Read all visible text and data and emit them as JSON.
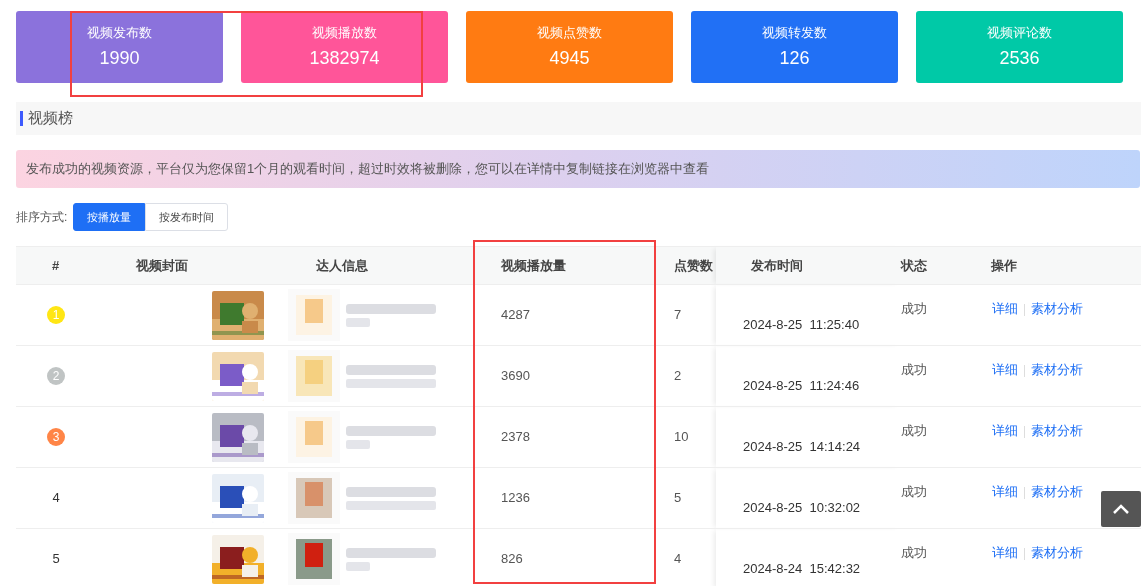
{
  "stats": [
    {
      "label": "视频发布数",
      "value": "1990",
      "color": "#8b72dc"
    },
    {
      "label": "视频播放数",
      "value": "1382974",
      "color": "#ff5599"
    },
    {
      "label": "视频点赞数",
      "value": "4945",
      "color": "#ff7b12"
    },
    {
      "label": "视频转发数",
      "value": "126",
      "color": "#2170f5"
    },
    {
      "label": "视频评论数",
      "value": "2536",
      "color": "#00c9a7"
    }
  ],
  "section_title": "视频榜",
  "notice": "发布成功的视频资源，平台仅为您保留1个月的观看时间，超过时效将被删除，您可以在详情中复制链接在浏览器中查看",
  "sort": {
    "label": "排序方式:",
    "options": [
      {
        "label": "按播放量",
        "selected": true
      },
      {
        "label": "按发布时间",
        "selected": false
      }
    ]
  },
  "table": {
    "columns": [
      "#",
      "视频封面",
      "达人信息",
      "视频播放量",
      "点赞数",
      "发布时间",
      "状态",
      "操作"
    ],
    "rows": [
      {
        "rank": "1",
        "color": "#ffe614",
        "plays": "4287",
        "likes": "7",
        "time": "2024-8-25  11:25:40",
        "status": "成功",
        "actions": [
          "详细",
          "素材分析"
        ]
      },
      {
        "rank": "2",
        "color": "#c0c4c4",
        "plays": "3690",
        "likes": "2",
        "time": "2024-8-25  11:24:46",
        "status": "成功",
        "actions": [
          "详细",
          "素材分析"
        ]
      },
      {
        "rank": "3",
        "color": "#ff8547",
        "plays": "2378",
        "likes": "10",
        "time": "2024-8-25  14:14:24",
        "status": "成功",
        "actions": [
          "详细",
          "素材分析"
        ]
      },
      {
        "rank": "4",
        "plays": "1236",
        "likes": "5",
        "time": "2024-8-25  10:32:02",
        "status": "成功",
        "actions": [
          "详细",
          "素材分析"
        ]
      },
      {
        "rank": "5",
        "plays": "826",
        "likes": "4",
        "time": "2024-8-24  15:42:32",
        "status": "成功",
        "actions": [
          "详细",
          "素材分析"
        ]
      }
    ]
  }
}
